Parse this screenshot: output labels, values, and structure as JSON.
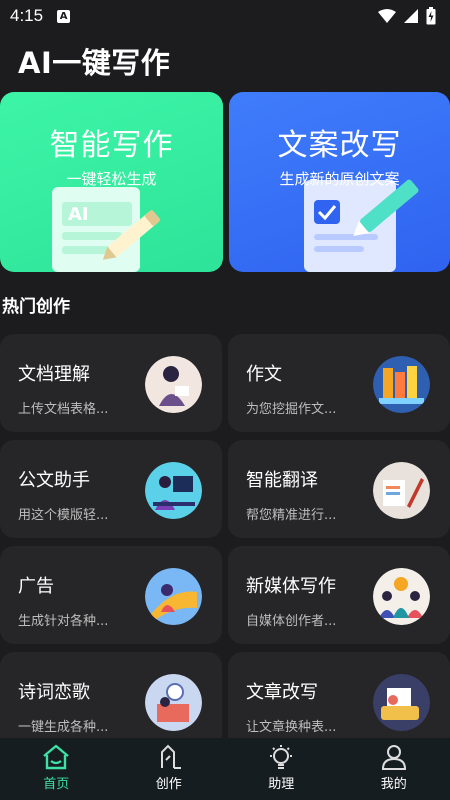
{
  "status": {
    "time": "4:15",
    "notif": "A"
  },
  "app": {
    "title": "AI一键写作"
  },
  "hero": [
    {
      "title": "智能写作",
      "subtitle": "一键轻松生成",
      "badge": "AI",
      "color": "#3df5a6"
    },
    {
      "title": "文案改写",
      "subtitle": "生成新的原创文案",
      "color": "#3f7dfb"
    }
  ],
  "section": {
    "title": "热门创作"
  },
  "cards": [
    {
      "title": "文档理解",
      "desc": "上传文档表格...",
      "thumb": "reading-woman-icon"
    },
    {
      "title": "作文",
      "desc": "为您挖掘作文...",
      "thumb": "books-icon"
    },
    {
      "title": "公文助手",
      "desc": "用这个模版轻...",
      "thumb": "office-worker-icon"
    },
    {
      "title": "智能翻译",
      "desc": "帮您精准进行...",
      "thumb": "writing-desk-icon"
    },
    {
      "title": "广告",
      "desc": "生成针对各种...",
      "thumb": "megaphone-icon"
    },
    {
      "title": "新媒体写作",
      "desc": "自媒体创作者...",
      "thumb": "team-icon"
    },
    {
      "title": "诗词恋歌",
      "desc": "一键生成各种...",
      "thumb": "clock-icon"
    },
    {
      "title": "文章改写",
      "desc": "让文章换种表...",
      "thumb": "typewriter-icon"
    }
  ],
  "tabs": [
    {
      "label": "首页",
      "icon": "home-icon",
      "active": true
    },
    {
      "label": "创作",
      "icon": "pen-icon",
      "active": false
    },
    {
      "label": "助理",
      "icon": "bulb-icon",
      "active": false
    },
    {
      "label": "我的",
      "icon": "user-icon",
      "active": false
    }
  ],
  "colors": {
    "accent": "#3ee0a3",
    "background": "#1c1c1e",
    "card": "#262628",
    "tabbar": "#161d21"
  }
}
